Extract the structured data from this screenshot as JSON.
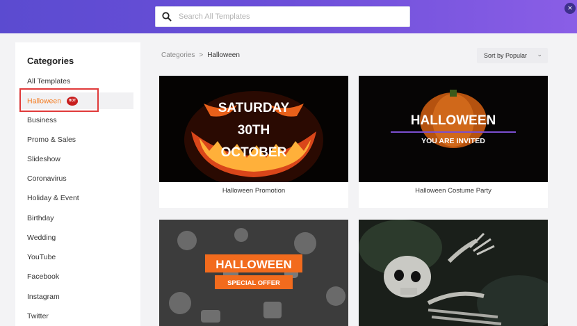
{
  "search": {
    "placeholder": "Search All Templates"
  },
  "close_label": "×",
  "sidebar": {
    "title": "Categories",
    "items": [
      {
        "label": "All Templates"
      },
      {
        "label": "Halloween",
        "badge": "HOT",
        "active": true
      },
      {
        "label": "Business"
      },
      {
        "label": "Promo & Sales"
      },
      {
        "label": "Slideshow"
      },
      {
        "label": "Coronavirus"
      },
      {
        "label": "Holiday & Event"
      },
      {
        "label": "Birthday"
      },
      {
        "label": "Wedding"
      },
      {
        "label": "YouTube"
      },
      {
        "label": "Facebook"
      },
      {
        "label": "Instagram"
      },
      {
        "label": "Twitter"
      }
    ]
  },
  "breadcrumb": {
    "root": "Categories",
    "separator": ">",
    "current": "Halloween"
  },
  "sort": {
    "label": "Sort by Popular",
    "chevron": "⌄"
  },
  "templates": [
    {
      "title": "Halloween Promotion",
      "thumb_text": [
        "SATURDAY",
        "30TH",
        "OCTOBER"
      ]
    },
    {
      "title": "Halloween Costume Party",
      "thumb_text": [
        "HALLOWEEN",
        "YOU ARE INVITED"
      ]
    },
    {
      "title": "",
      "thumb_text": [
        "HALLOWEEN",
        "SPECIAL OFFER"
      ]
    },
    {
      "title": "",
      "thumb_text": []
    }
  ],
  "colors": {
    "accent": "#f47b20",
    "hot_badge": "#c81e1e",
    "highlight": "#e03a3a",
    "header_start": "#5b4bd0",
    "header_end": "#8a5ee6"
  }
}
